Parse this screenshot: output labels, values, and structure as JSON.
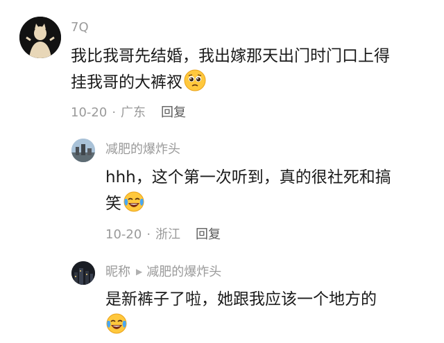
{
  "comments": [
    {
      "username": "7Q",
      "text_lines": [
        "我比我哥先结婚，我出嫁那天出门时门口上得",
        "挂我哥的大裤衩"
      ],
      "emoji": "pleading-face-emoji",
      "date": "10-20",
      "dot": "·",
      "location": "广东",
      "reply_label": "回复"
    },
    {
      "username": "减肥的爆炸头",
      "text_lines": [
        "hhh，这个第一次听到，真的很社死和搞",
        "笑"
      ],
      "emoji": "tears-of-joy-emoji",
      "date": "10-20",
      "dot": "·",
      "location": "浙江",
      "reply_label": "回复"
    },
    {
      "username": "昵称",
      "reply_to": "减肥的爆炸头",
      "reply_arrow": "▶",
      "text_lines": [
        "是新裤子了啦，她跟我应该一个地方的"
      ],
      "emoji": "tears-of-joy-emoji"
    }
  ]
}
